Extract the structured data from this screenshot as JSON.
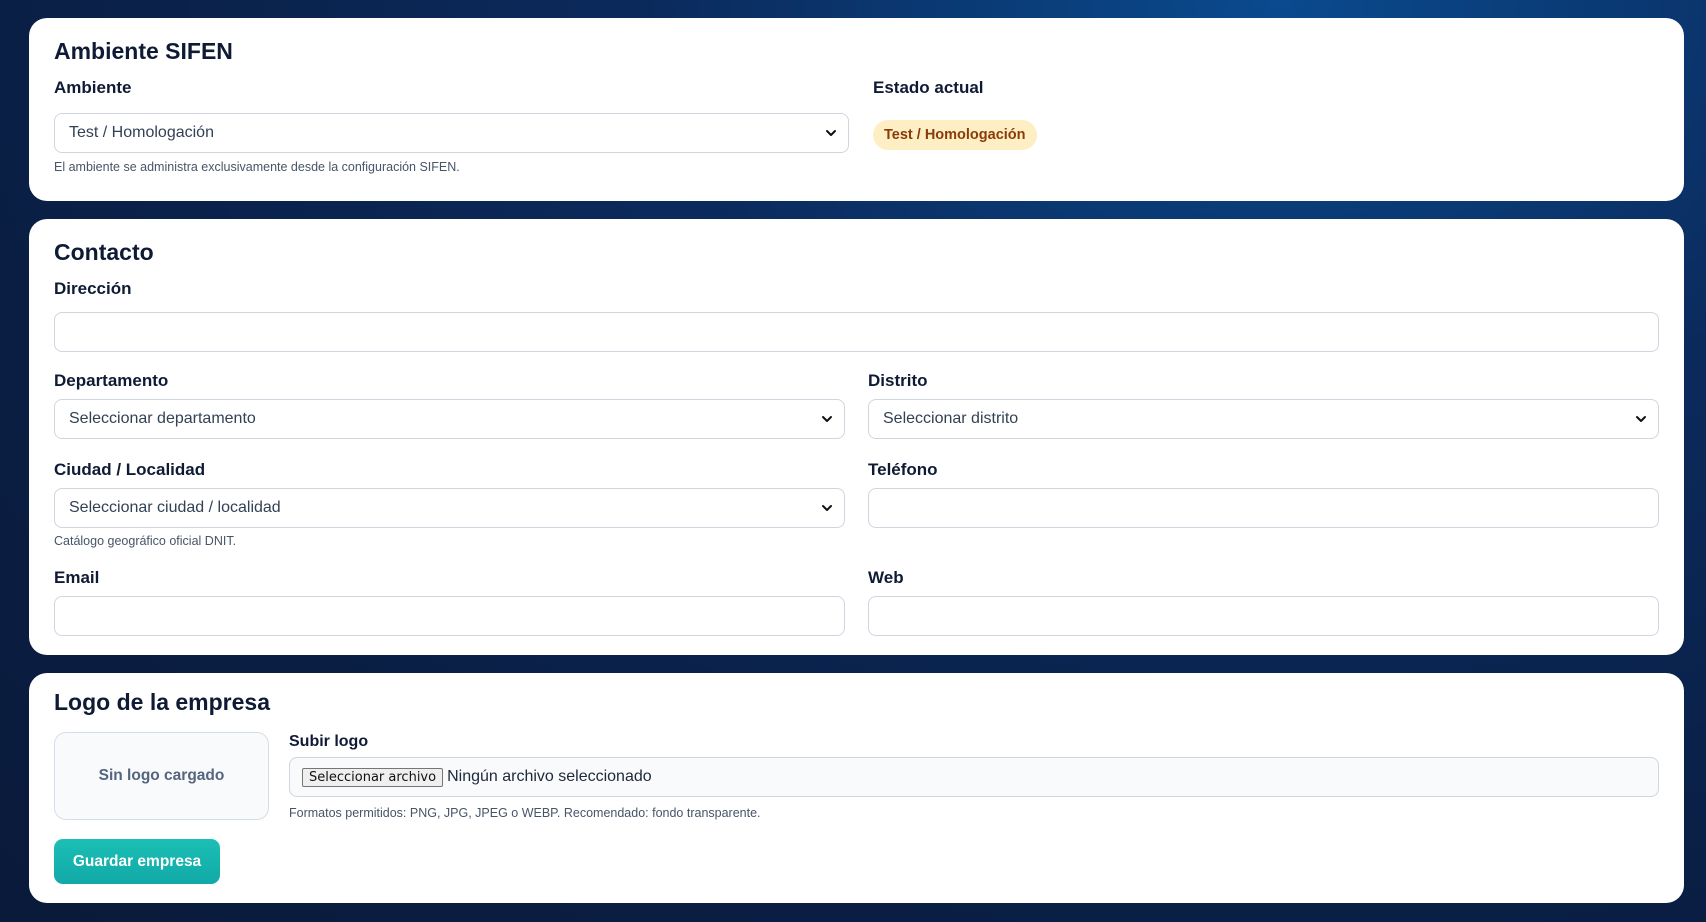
{
  "ambiente": {
    "title": "Ambiente SIFEN",
    "field_label": "Ambiente",
    "selected": "Test / Homologación",
    "help": "El ambiente se administra exclusivamente desde la configuración SIFEN.",
    "status_label": "Estado actual",
    "status_badge": "Test / Homologación"
  },
  "contacto": {
    "title": "Contacto",
    "direccion_label": "Dirección",
    "direccion_value": "",
    "departamento_label": "Departamento",
    "departamento_selected": "Seleccionar departamento",
    "distrito_label": "Distrito",
    "distrito_selected": "Seleccionar distrito",
    "ciudad_label": "Ciudad / Localidad",
    "ciudad_selected": "Seleccionar ciudad / localidad",
    "ciudad_help": "Catálogo geográfico oficial DNIT.",
    "telefono_label": "Teléfono",
    "telefono_value": "",
    "email_label": "Email",
    "email_value": "",
    "web_label": "Web",
    "web_value": ""
  },
  "logo": {
    "title": "Logo de la empresa",
    "placeholder": "Sin logo cargado",
    "upload_label": "Subir logo",
    "file_button": "Seleccionar archivo",
    "file_status": "Ningún archivo seleccionado",
    "help": "Formatos permitidos: PNG, JPG, JPEG o WEBP. Recomendado: fondo transparente."
  },
  "actions": {
    "save_label": "Guardar empresa"
  },
  "colors": {
    "background": "#0b2a5c",
    "card": "#ffffff",
    "badge_bg": "#fdefc3",
    "badge_text": "#8a3b0a",
    "primary": "#14b1ad"
  }
}
